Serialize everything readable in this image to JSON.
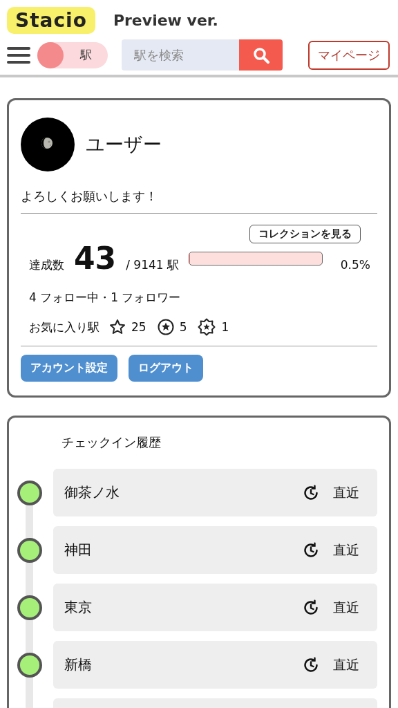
{
  "header": {
    "logo": "Stacio",
    "subtitle": "Preview ver.",
    "mode_toggle": {
      "label": "駅",
      "on": false
    },
    "search": {
      "placeholder": "駅を検索"
    },
    "mypage_button": "マイページ"
  },
  "profile": {
    "name": "ユーザー",
    "bio": "よろしくお願いします！",
    "collection_button": "コレクションを見る",
    "achieved_label": "達成数",
    "achieved_count": "43",
    "total": "/ 9141 駅",
    "level": 0.005,
    "percent": "0.5%",
    "follow": "4 フォロー中・1 フォロワー",
    "favorites_label": "お気に入り駅",
    "favorites": [
      {
        "kind": "star",
        "count": "25"
      },
      {
        "kind": "circle-star",
        "count": "5"
      },
      {
        "kind": "badge-star",
        "count": "1"
      }
    ],
    "buttons": [
      "アカウント設定",
      "ログアウト"
    ]
  },
  "history": {
    "title": "チェックイン履歴",
    "items": [
      {
        "station": "御茶ノ水",
        "time": "直近"
      },
      {
        "station": "神田",
        "time": "直近"
      },
      {
        "station": "東京",
        "time": "直近"
      },
      {
        "station": "新橋",
        "time": "直近"
      }
    ]
  }
}
